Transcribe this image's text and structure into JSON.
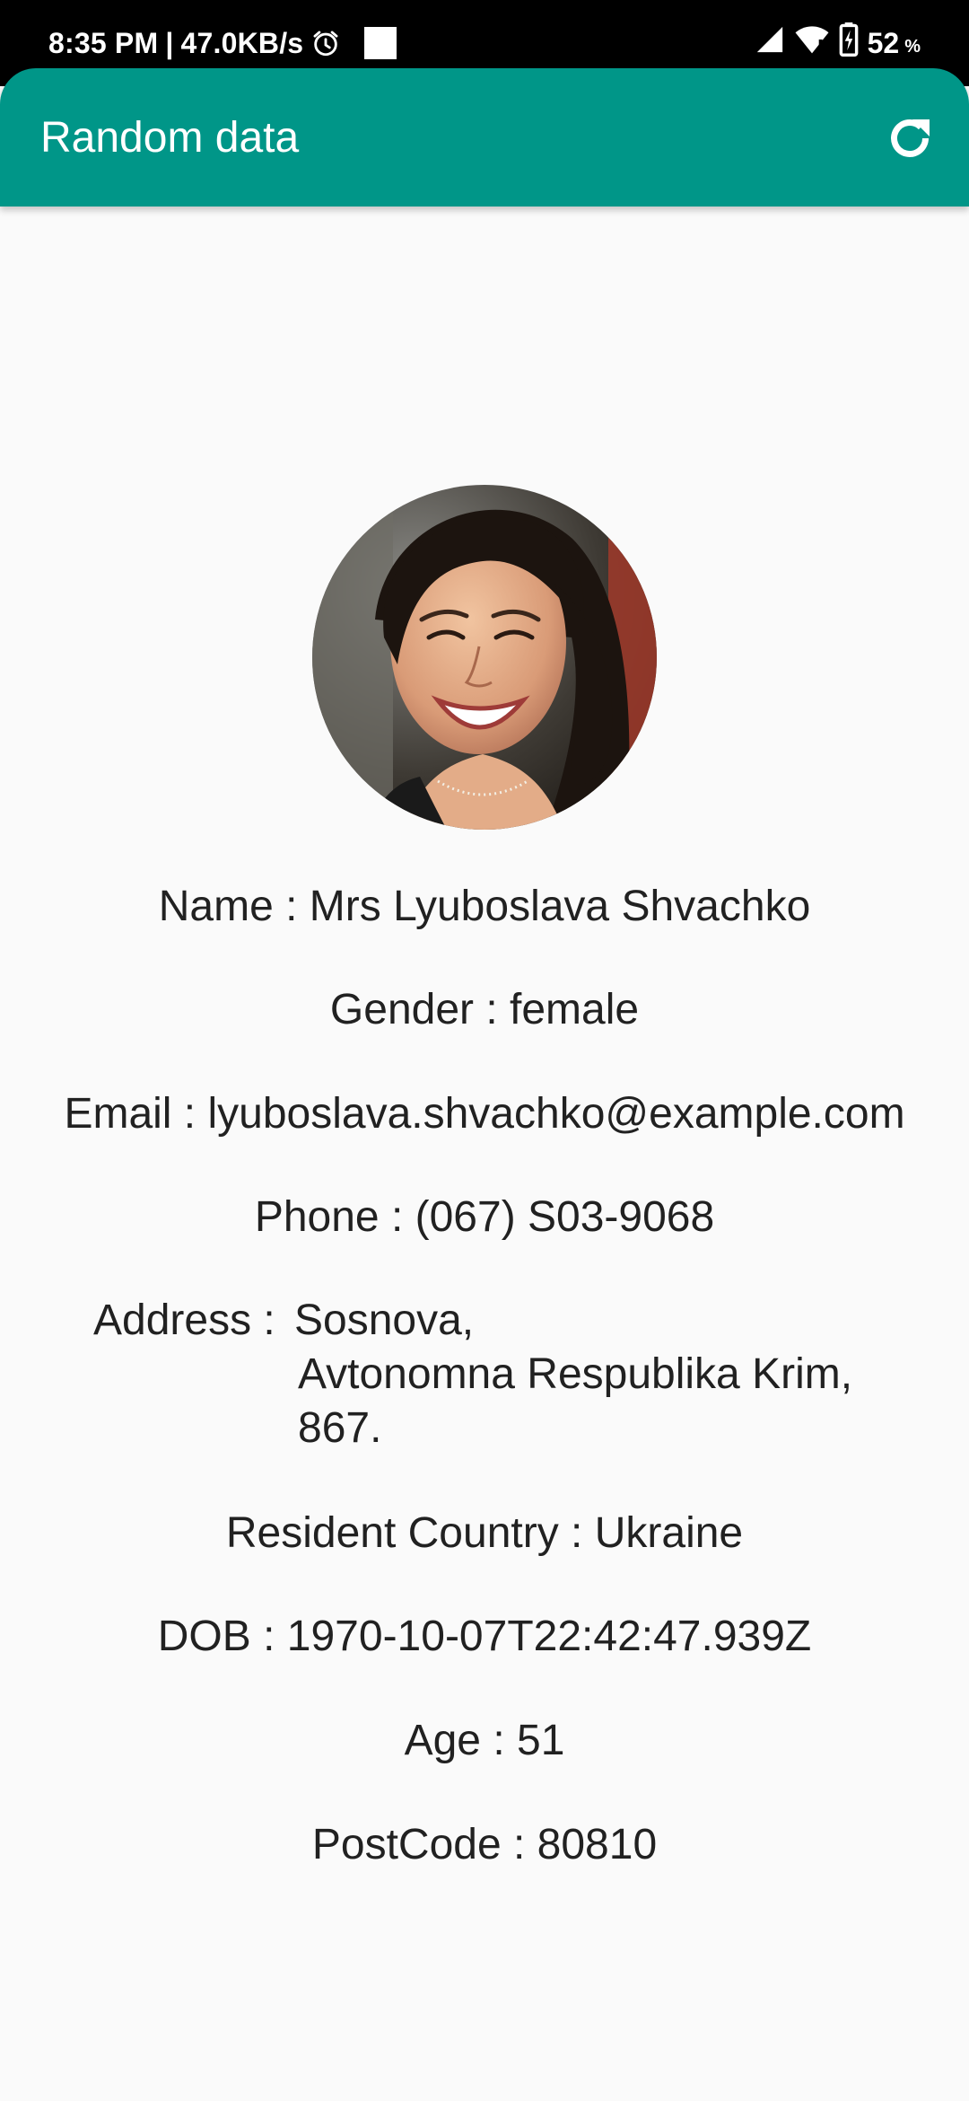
{
  "status_bar": {
    "time": "8:35 PM",
    "separator": "|",
    "speed": "47.0KB/s",
    "battery": "52",
    "battery_unit": "%"
  },
  "app_bar": {
    "title": "Random data",
    "refresh_icon": "refresh-icon",
    "color": "#009688"
  },
  "profile": {
    "avatar_icon": "profile-photo",
    "name_line": "Name : Mrs Lyuboslava Shvachko",
    "gender_line": "Gender : female",
    "email_line": "Email : lyuboslava.shvachko@example.com",
    "phone_line": "Phone : (067) S03-9068",
    "address_label": "Address :",
    "address_lines": [
      "Sosnova,",
      "Avtonomna Respublika Krim,",
      "867."
    ],
    "country_line": "Resident Country : Ukraine",
    "dob_line": "DOB : 1970-10-07T22:42:47.939Z",
    "age_line": "Age : 51",
    "postcode_line": "PostCode : 80810"
  }
}
